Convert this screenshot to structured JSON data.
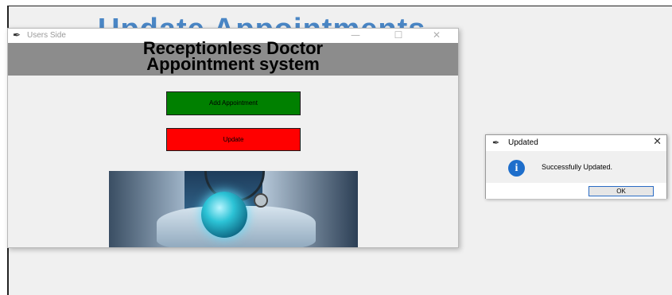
{
  "background_window": {
    "title": "Update Appointments"
  },
  "users_window": {
    "title": "Users Side",
    "controls": {
      "minimize": "—",
      "maximize": "☐",
      "close": "✕"
    },
    "banner": {
      "line1": "Receptionless Doctor",
      "line2": "Appointment system",
      "color": "#8c8c8c"
    },
    "buttons": {
      "add_label": "Add Appointment",
      "add_color": "#008000",
      "update_label": "Update",
      "update_color": "#ff0000"
    },
    "image": {
      "icon": "doctor-globe-photo"
    }
  },
  "message_box": {
    "title": "Updated",
    "close": "✕",
    "message": "Successfully Updated.",
    "icon": "info-icon",
    "ok_label": "OK"
  }
}
